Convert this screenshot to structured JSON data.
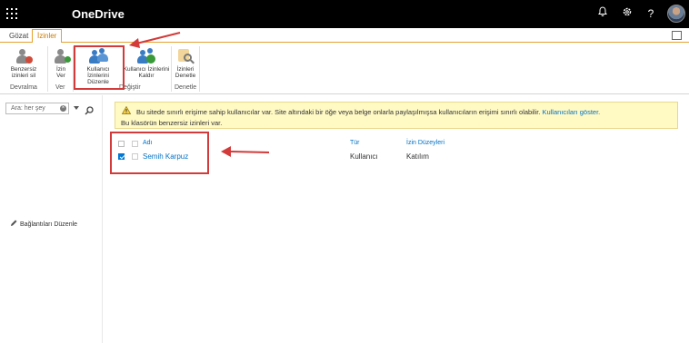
{
  "app": {
    "title": "OneDrive"
  },
  "tabs": [
    "Gözat",
    "İzinler"
  ],
  "ribbon": {
    "buttons": [
      {
        "label": "Benzersiz izinleri sil",
        "icon": "delete-unique-permissions-icon"
      },
      {
        "label": "İzin Ver",
        "icon": "grant-permissions-icon"
      },
      {
        "label": "Kullanıcı İzinlerini Düzenle",
        "icon": "edit-user-permissions-icon"
      },
      {
        "label": "Kullanıcı İzinlerini Kaldır",
        "icon": "remove-user-permissions-icon"
      },
      {
        "label": "İzinleri Denetle",
        "icon": "check-permissions-icon"
      }
    ],
    "groups": [
      "Devralma",
      "Ver",
      "Değiştir",
      "Denetle"
    ]
  },
  "search": {
    "placeholder": "Ara: her şey"
  },
  "leftnav": {
    "edit_links": "Bağlantıları Düzenle"
  },
  "warning": {
    "line1": "Bu sitede sınırlı erişime sahip kullanıcılar var. Site altındaki bir öğe veya belge onlarla paylaşılmışsa kullanıcıların erişimi sınırlı olabilir.",
    "link": "Kullanıcıları göster.",
    "line2": "Bu klasörün benzersiz izinleri var."
  },
  "table": {
    "headers": [
      "Adı",
      "Tür",
      "İzin Düzeyleri"
    ],
    "rows": [
      {
        "name": "Semih Karpuz",
        "type": "Kullanıcı",
        "level": "Katılım",
        "checked": true
      }
    ]
  },
  "colors": {
    "accent": "#e6a02c",
    "link": "#0072c6",
    "annotation": "#d33a3a"
  }
}
